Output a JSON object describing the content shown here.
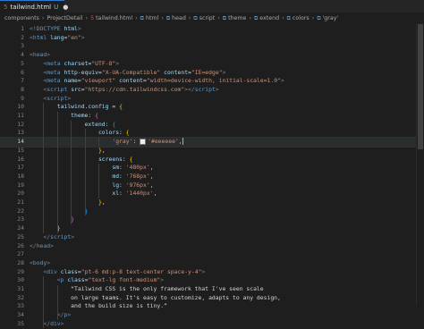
{
  "tab": {
    "name": "tailwind.html",
    "modified_marker": "U",
    "dot": "●"
  },
  "breadcrumb": [
    "components",
    "ProjectDetail",
    "tailwind.html",
    "html",
    "head",
    "script",
    "theme",
    "extend",
    "colors",
    "'gray'"
  ],
  "editor": {
    "active_line": 14,
    "lines": [
      {
        "n": "1",
        "segs": [
          [
            "t",
            "<"
          ],
          [
            "tag",
            "!DOCTYPE"
          ],
          [
            "txt",
            " "
          ],
          [
            "attr",
            "html"
          ],
          [
            "t",
            ">"
          ]
        ]
      },
      {
        "n": "2",
        "segs": [
          [
            "t",
            "<"
          ],
          [
            "tag",
            "html"
          ],
          [
            "txt",
            " "
          ],
          [
            "attr",
            "lang"
          ],
          [
            "txt",
            "="
          ],
          [
            "str",
            "\"en\""
          ],
          [
            "t",
            ">"
          ]
        ]
      },
      {
        "n": "3",
        "segs": []
      },
      {
        "n": "4",
        "segs": [
          [
            "t",
            "<"
          ],
          [
            "tag",
            "head"
          ],
          [
            "t",
            ">"
          ]
        ]
      },
      {
        "n": "5",
        "segs": [
          [
            "txt",
            "    "
          ],
          [
            "t",
            "<"
          ],
          [
            "tag",
            "meta"
          ],
          [
            "txt",
            " "
          ],
          [
            "attr",
            "charset"
          ],
          [
            "txt",
            "="
          ],
          [
            "str",
            "\"UTF-8\""
          ],
          [
            "t",
            ">"
          ]
        ]
      },
      {
        "n": "6",
        "segs": [
          [
            "txt",
            "    "
          ],
          [
            "t",
            "<"
          ],
          [
            "tag",
            "meta"
          ],
          [
            "txt",
            " "
          ],
          [
            "attr",
            "http-equiv"
          ],
          [
            "txt",
            "="
          ],
          [
            "str",
            "\"X-UA-Compatible\""
          ],
          [
            "txt",
            " "
          ],
          [
            "attr",
            "content"
          ],
          [
            "txt",
            "="
          ],
          [
            "str",
            "\"IE=edge\""
          ],
          [
            "t",
            ">"
          ]
        ]
      },
      {
        "n": "7",
        "segs": [
          [
            "txt",
            "    "
          ],
          [
            "t",
            "<"
          ],
          [
            "tag",
            "meta"
          ],
          [
            "txt",
            " "
          ],
          [
            "attr",
            "name"
          ],
          [
            "txt",
            "="
          ],
          [
            "str",
            "\"viewport\""
          ],
          [
            "txt",
            " "
          ],
          [
            "attr",
            "content"
          ],
          [
            "txt",
            "="
          ],
          [
            "str",
            "\"width=device-width, initial-scale=1.0\""
          ],
          [
            "t",
            ">"
          ]
        ]
      },
      {
        "n": "8",
        "segs": [
          [
            "txt",
            "    "
          ],
          [
            "t",
            "<"
          ],
          [
            "tag",
            "script"
          ],
          [
            "txt",
            " "
          ],
          [
            "attr",
            "src"
          ],
          [
            "txt",
            "="
          ],
          [
            "str",
            "\"https://cdn.tailwindcss.com\""
          ],
          [
            "t",
            "></"
          ],
          [
            "tag",
            "script"
          ],
          [
            "t",
            ">"
          ]
        ]
      },
      {
        "n": "9",
        "segs": [
          [
            "txt",
            "    "
          ],
          [
            "t",
            "<"
          ],
          [
            "tag",
            "script"
          ],
          [
            "t",
            ">"
          ]
        ]
      },
      {
        "n": "10",
        "segs": [
          [
            "txt",
            "        "
          ],
          [
            "key",
            "tailwind"
          ],
          [
            "txt",
            "."
          ],
          [
            "key",
            "config"
          ],
          [
            "txt",
            " = "
          ],
          [
            "br1",
            "{"
          ]
        ]
      },
      {
        "n": "11",
        "segs": [
          [
            "txt",
            "            "
          ],
          [
            "key",
            "theme"
          ],
          [
            "txt",
            ": "
          ],
          [
            "br2",
            "{"
          ]
        ]
      },
      {
        "n": "12",
        "segs": [
          [
            "txt",
            "                "
          ],
          [
            "key",
            "extend"
          ],
          [
            "txt",
            ": "
          ],
          [
            "br3",
            "{"
          ]
        ]
      },
      {
        "n": "13",
        "segs": [
          [
            "txt",
            "                    "
          ],
          [
            "key",
            "colors"
          ],
          [
            "txt",
            ": "
          ],
          [
            "br1",
            "{"
          ]
        ]
      },
      {
        "n": "14",
        "segs": [
          [
            "txt",
            "                        "
          ],
          [
            "str",
            "'gray'"
          ],
          [
            "txt",
            ": "
          ],
          [
            "sq",
            ""
          ],
          [
            "str",
            "'#eeeeee'"
          ],
          [
            "txt",
            ","
          ],
          [
            "cursor",
            ""
          ]
        ]
      },
      {
        "n": "15",
        "segs": [
          [
            "txt",
            "                    "
          ],
          [
            "br1",
            "}"
          ],
          [
            "txt",
            ","
          ]
        ]
      },
      {
        "n": "16",
        "segs": [
          [
            "txt",
            "                    "
          ],
          [
            "key",
            "screens"
          ],
          [
            "txt",
            ": "
          ],
          [
            "br1",
            "{"
          ]
        ]
      },
      {
        "n": "17",
        "segs": [
          [
            "txt",
            "                        "
          ],
          [
            "key",
            "sm"
          ],
          [
            "txt",
            ": "
          ],
          [
            "str",
            "'480px'"
          ],
          [
            "txt",
            ","
          ]
        ]
      },
      {
        "n": "18",
        "segs": [
          [
            "txt",
            "                        "
          ],
          [
            "key",
            "md"
          ],
          [
            "txt",
            ": "
          ],
          [
            "str",
            "'768px'"
          ],
          [
            "txt",
            ","
          ]
        ]
      },
      {
        "n": "19",
        "segs": [
          [
            "txt",
            "                        "
          ],
          [
            "key",
            "lg"
          ],
          [
            "txt",
            ": "
          ],
          [
            "str",
            "'976px'"
          ],
          [
            "txt",
            ","
          ]
        ]
      },
      {
        "n": "20",
        "segs": [
          [
            "txt",
            "                        "
          ],
          [
            "key",
            "xl"
          ],
          [
            "txt",
            ": "
          ],
          [
            "str",
            "'1440px'"
          ],
          [
            "txt",
            ","
          ]
        ]
      },
      {
        "n": "21",
        "segs": [
          [
            "txt",
            "                    "
          ],
          [
            "br1",
            "}"
          ],
          [
            "txt",
            ","
          ]
        ]
      },
      {
        "n": "22",
        "segs": [
          [
            "txt",
            "                "
          ],
          [
            "br3",
            "}"
          ]
        ]
      },
      {
        "n": "23",
        "segs": [
          [
            "txt",
            "            "
          ],
          [
            "br2",
            "}"
          ]
        ]
      },
      {
        "n": "24",
        "segs": [
          [
            "txt",
            "        "
          ],
          [
            "br1",
            "}"
          ]
        ]
      },
      {
        "n": "25",
        "segs": [
          [
            "txt",
            "    "
          ],
          [
            "t",
            "</"
          ],
          [
            "tag",
            "script"
          ],
          [
            "t",
            ">"
          ]
        ]
      },
      {
        "n": "26",
        "segs": [
          [
            "t",
            "</"
          ],
          [
            "tag",
            "head"
          ],
          [
            "t",
            ">"
          ]
        ]
      },
      {
        "n": "27",
        "segs": []
      },
      {
        "n": "28",
        "segs": [
          [
            "t",
            "<"
          ],
          [
            "tag",
            "body"
          ],
          [
            "t",
            ">"
          ]
        ]
      },
      {
        "n": "29",
        "segs": [
          [
            "txt",
            "    "
          ],
          [
            "t",
            "<"
          ],
          [
            "tag",
            "div"
          ],
          [
            "txt",
            " "
          ],
          [
            "attr",
            "class"
          ],
          [
            "txt",
            "="
          ],
          [
            "str",
            "\"pt-6 md:p-8 text-center space-y-4\""
          ],
          [
            "t",
            ">"
          ]
        ]
      },
      {
        "n": "30",
        "segs": [
          [
            "txt",
            "        "
          ],
          [
            "t",
            "<"
          ],
          [
            "tag",
            "p"
          ],
          [
            "txt",
            " "
          ],
          [
            "attr",
            "class"
          ],
          [
            "txt",
            "="
          ],
          [
            "str",
            "\"text-lg font-medium\""
          ],
          [
            "t",
            ">"
          ]
        ]
      },
      {
        "n": "31",
        "segs": [
          [
            "txt",
            "            “Tailwind CSS is the only framework that I've seen scale"
          ]
        ]
      },
      {
        "n": "32",
        "segs": [
          [
            "txt",
            "            on large teams. It’s easy to customize, adapts to any design,"
          ]
        ]
      },
      {
        "n": "33",
        "segs": [
          [
            "txt",
            "            and the build size is tiny.”"
          ]
        ]
      },
      {
        "n": "34",
        "segs": [
          [
            "txt",
            "        "
          ],
          [
            "t",
            "</"
          ],
          [
            "tag",
            "p"
          ],
          [
            "t",
            ">"
          ]
        ]
      },
      {
        "n": "35",
        "segs": [
          [
            "txt",
            "    "
          ],
          [
            "t",
            "</"
          ],
          [
            "tag",
            "div"
          ],
          [
            "t",
            ">"
          ]
        ]
      }
    ]
  }
}
